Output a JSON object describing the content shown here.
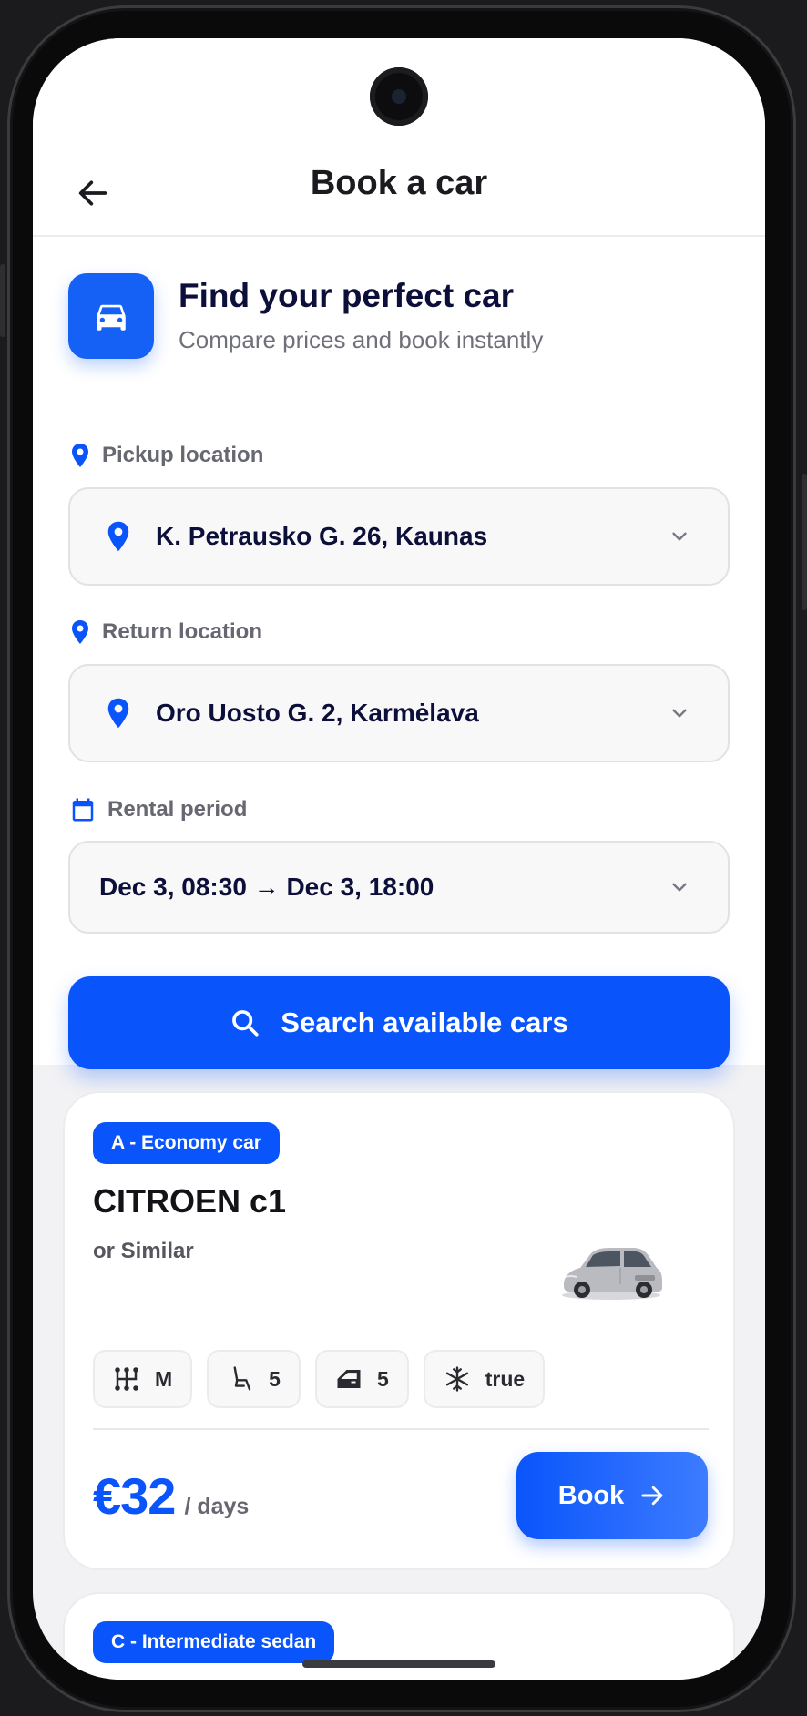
{
  "header": {
    "title": "Book a car"
  },
  "hero": {
    "title": "Find your perfect car",
    "subtitle": "Compare prices and book instantly"
  },
  "form": {
    "pickup": {
      "label": "Pickup location",
      "value": "K. Petrausko G. 26, Kaunas"
    },
    "return": {
      "label": "Return location",
      "value": "Oro Uosto G. 2, Karmėlava"
    },
    "period": {
      "label": "Rental period",
      "value": "Dec 3, 08:30 → Dec 3, 18:00"
    },
    "search_label": "Search available cars"
  },
  "cars": [
    {
      "category": "A - Economy car",
      "name": "CITROEN c1",
      "similar": "or Similar",
      "specs": {
        "transmission": "M",
        "seats": "5",
        "doors": "5",
        "ac": "true"
      },
      "price": "€32",
      "price_unit": "/ days",
      "book_label": "Book"
    },
    {
      "category": "C - Intermediate sedan"
    }
  ],
  "colors": {
    "accent": "#0a55fb",
    "title": "#0c0f3a",
    "muted": "#6f7079"
  },
  "icons": {
    "back": "arrow-left-icon",
    "hero": "car-icon",
    "pin": "location-pin-icon",
    "calendar": "calendar-icon",
    "chevron": "chevron-down-icon",
    "search": "search-icon",
    "transmission": "gearbox-icon",
    "seat": "seat-icon",
    "door": "door-icon",
    "ac": "snowflake-icon",
    "book": "arrow-right-icon"
  }
}
